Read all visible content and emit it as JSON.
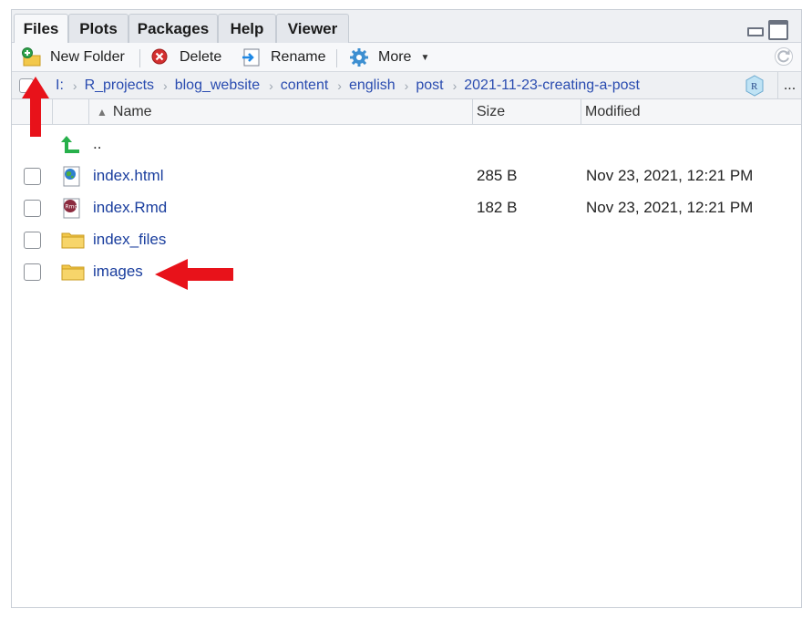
{
  "tabs": [
    {
      "label": "Files",
      "active": true
    },
    {
      "label": "Plots",
      "active": false
    },
    {
      "label": "Packages",
      "active": false
    },
    {
      "label": "Help",
      "active": false
    },
    {
      "label": "Viewer",
      "active": false
    }
  ],
  "toolbar": {
    "new_folder": "New Folder",
    "delete": "Delete",
    "rename": "Rename",
    "more": "More"
  },
  "breadcrumb": [
    "I:",
    "R_projects",
    "blog_website",
    "content",
    "english",
    "post",
    "2021-11-23-creating-a-post"
  ],
  "breadcrumb_more": "...",
  "columns": {
    "name": "Name",
    "size": "Size",
    "modified": "Modified"
  },
  "parent_label": "..",
  "files": [
    {
      "name": "index.html",
      "size": "285 B",
      "modified": "Nov 23, 2021, 12:21 PM",
      "icon": "html-file-icon"
    },
    {
      "name": "index.Rmd",
      "size": "182 B",
      "modified": "Nov 23, 2021, 12:21 PM",
      "icon": "rmd-file-icon"
    },
    {
      "name": "index_files",
      "size": "",
      "modified": "",
      "icon": "folder-icon"
    },
    {
      "name": "images",
      "size": "",
      "modified": "",
      "icon": "folder-icon"
    }
  ],
  "colors": {
    "link": "#1a3e9e",
    "annotation_arrow": "#e8121a",
    "folder": "#f2c84b"
  }
}
